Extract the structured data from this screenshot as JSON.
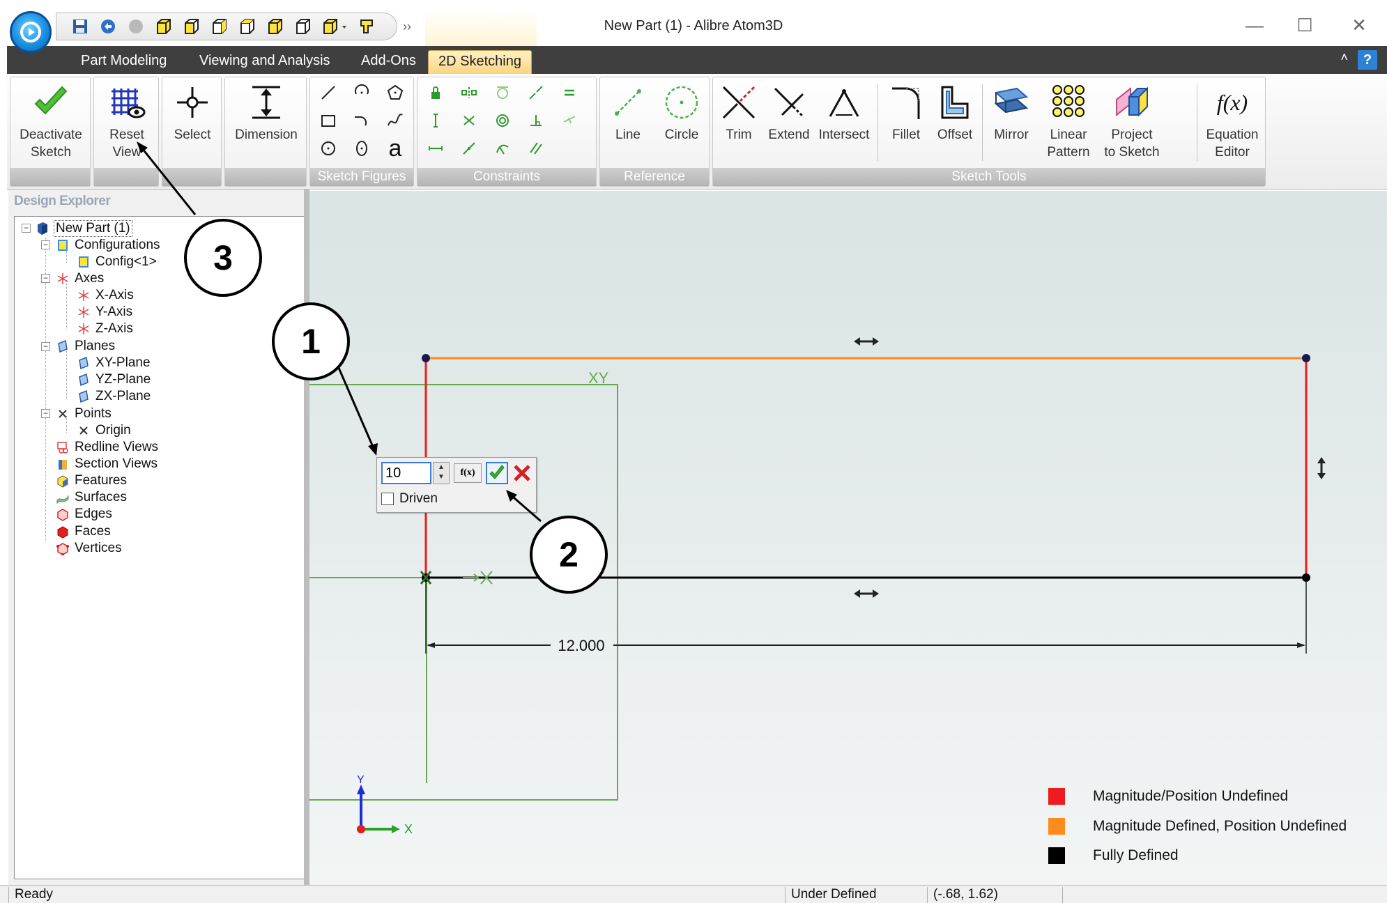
{
  "window": {
    "title": "New Part (1) - Alibre Atom3D",
    "minimize_icon": "minimize-icon",
    "maximize_icon": "maximize-icon",
    "close_icon": "close-icon"
  },
  "quick_access": [
    "save-icon",
    "undo-icon",
    "redo-icon",
    "box-icon",
    "box-icon",
    "box-icon",
    "box-icon",
    "box-icon",
    "box-icon",
    "box-dropdown-icon",
    "pointer-icon"
  ],
  "ribbon_tabs": [
    {
      "label": "Part Modeling",
      "active": false
    },
    {
      "label": "Viewing and Analysis",
      "active": false
    },
    {
      "label": "Add-Ons",
      "active": false
    },
    {
      "label": "2D Sketching",
      "active": true
    }
  ],
  "ribbon": {
    "deactivate": {
      "line1": "Deactivate",
      "line2": "Sketch"
    },
    "reset": {
      "line1": "Reset",
      "line2": "View"
    },
    "select": {
      "label": "Select"
    },
    "dimension": {
      "label": "Dimension"
    },
    "sketch_figures": {
      "label": "Sketch Figures",
      "text_glyph": "a"
    },
    "constraints": {
      "label": "Constraints"
    },
    "reference": {
      "label": "Reference",
      "line": "Line",
      "circle": "Circle"
    },
    "sketch_tools": {
      "label": "Sketch Tools",
      "trim": "Trim",
      "extend": "Extend",
      "intersect": "Intersect",
      "fillet": "Fillet",
      "offset": "Offset",
      "mirror": "Mirror",
      "linear_pattern": {
        "line1": "Linear",
        "line2": "Pattern"
      },
      "project": {
        "line1": "Project",
        "line2": "to Sketch"
      },
      "equation": {
        "glyph": "f(x)",
        "line1": "Equation",
        "line2": "Editor"
      }
    }
  },
  "explorer": {
    "title": "Design Explorer",
    "nodes": [
      {
        "label": "New Part (1)"
      },
      {
        "label": "Configurations"
      },
      {
        "label": "Config<1>"
      },
      {
        "label": "Axes"
      },
      {
        "label": "X-Axis"
      },
      {
        "label": "Y-Axis"
      },
      {
        "label": "Z-Axis"
      },
      {
        "label": "Planes"
      },
      {
        "label": "XY-Plane"
      },
      {
        "label": "YZ-Plane"
      },
      {
        "label": "ZX-Plane"
      },
      {
        "label": "Points"
      },
      {
        "label": "Origin"
      },
      {
        "label": "Redline Views"
      },
      {
        "label": "Section Views"
      },
      {
        "label": "Features"
      },
      {
        "label": "Surfaces"
      },
      {
        "label": "Edges"
      },
      {
        "label": "Faces"
      },
      {
        "label": "Vertices"
      }
    ]
  },
  "canvas": {
    "plane_label": "XY",
    "dimension_text": "12.000",
    "axis_y_label": "Y",
    "axis_x_label": "X",
    "colors": {
      "undefined": "#ee1c1c",
      "magnitude_defined": "#ff8c1a",
      "fully_defined": "#000000",
      "plane": "#6aa84f"
    }
  },
  "dim_popup": {
    "value": "10",
    "fx": "f(x)",
    "driven_label": "Driven",
    "driven_checked": false
  },
  "legend": [
    {
      "label": "Magnitude/Position Undefined",
      "color": "#ee1c1c"
    },
    {
      "label": "Magnitude Defined, Position Undefined",
      "color": "#ff8c1a"
    },
    {
      "label": "Fully Defined",
      "color": "#000000"
    }
  ],
  "callouts": [
    "1",
    "2",
    "3"
  ],
  "status": {
    "ready": "Ready",
    "state": "Under Defined",
    "coords": "(-.68, 1.62)"
  }
}
